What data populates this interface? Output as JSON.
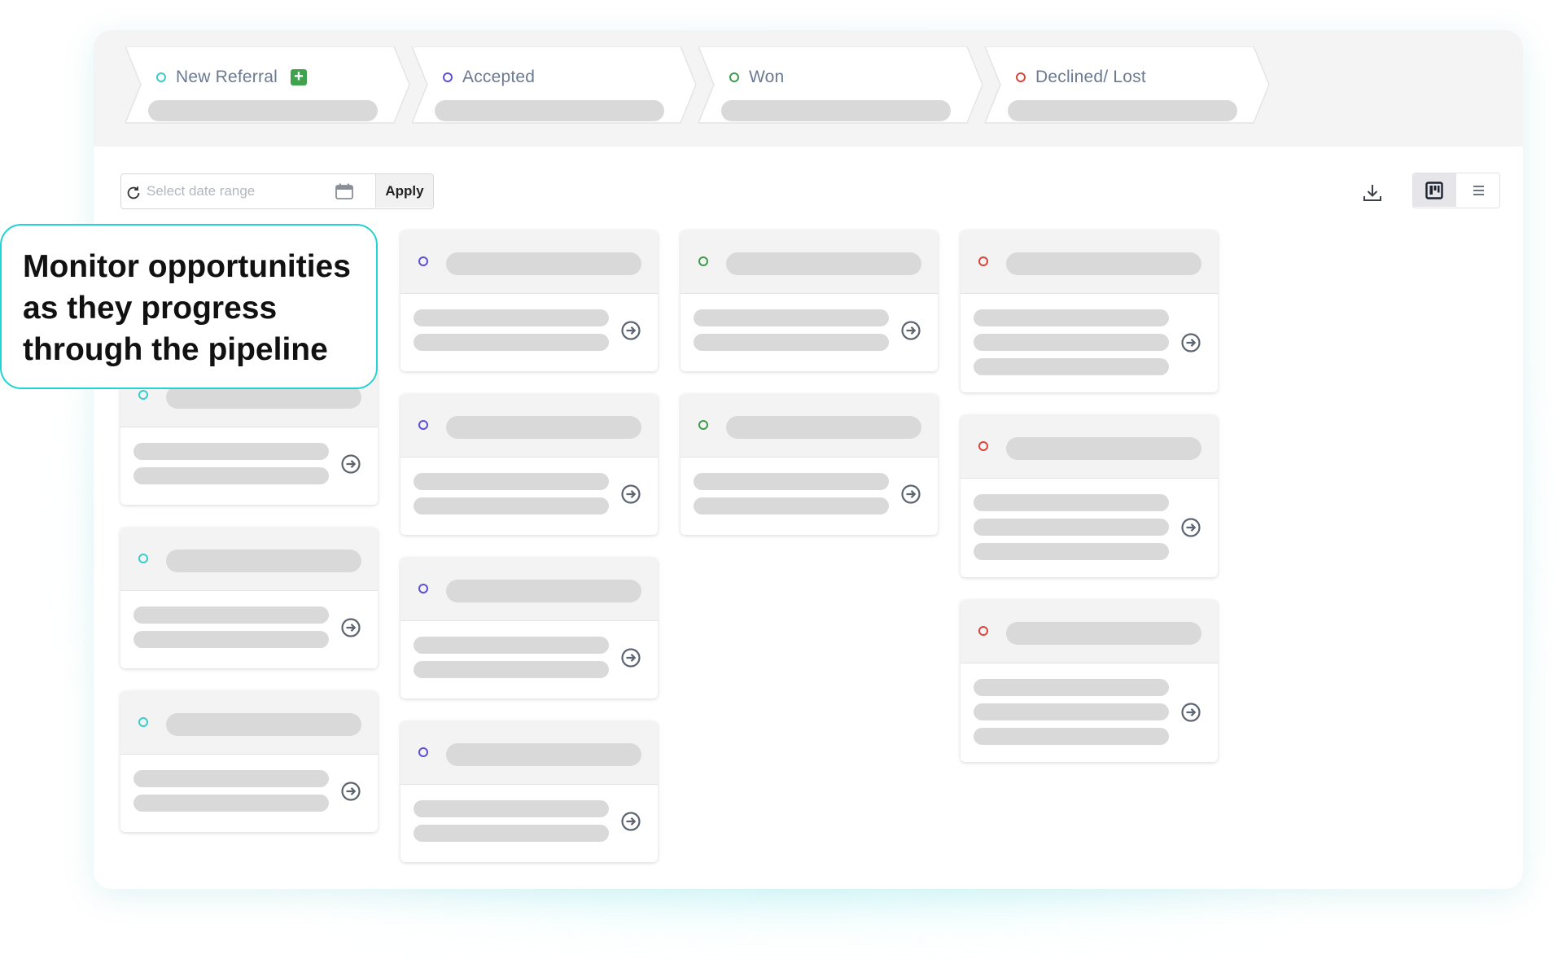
{
  "colors": {
    "new_referral": "#38cccc",
    "accepted": "#5b4fd6",
    "won": "#3f9a4b",
    "declined": "#d9443b",
    "skeleton": "#d9d9d9",
    "callout_border": "#22d3d3",
    "add_icon": "#3fa34d"
  },
  "pipeline": {
    "stages": [
      {
        "label": "New Referral",
        "status": "new_referral",
        "icon": "status-ring-icon",
        "has_add": true
      },
      {
        "label": "Accepted",
        "status": "accepted",
        "icon": "status-ring-icon",
        "has_add": false
      },
      {
        "label": "Won",
        "status": "won",
        "icon": "status-ring-icon",
        "has_add": false
      },
      {
        "label": "Declined/ Lost",
        "status": "declined",
        "icon": "status-ring-icon",
        "has_add": false
      }
    ]
  },
  "toolbar": {
    "date_placeholder": "Select date range",
    "apply_label": "Apply",
    "refresh_icon": "refresh-icon",
    "calendar_icon": "calendar-icon",
    "download_icon": "download-icon",
    "board_view_icon": "board-view-icon",
    "list_view_icon": "list-view-icon",
    "active_view": "board"
  },
  "columns": [
    {
      "status": "new_referral",
      "cards": [
        {
          "lines": 2
        },
        {
          "lines": 2
        },
        {
          "lines": 2
        }
      ]
    },
    {
      "status": "accepted",
      "cards": [
        {
          "lines": 2
        },
        {
          "lines": 2
        },
        {
          "lines": 2
        },
        {
          "lines": 2
        }
      ]
    },
    {
      "status": "won",
      "cards": [
        {
          "lines": 2
        },
        {
          "lines": 2
        }
      ]
    },
    {
      "status": "declined",
      "cards": [
        {
          "lines": 3
        },
        {
          "lines": 3
        },
        {
          "lines": 3
        }
      ]
    }
  ],
  "callout": {
    "text": "Monitor opportunities as they progress through the pipeline"
  }
}
